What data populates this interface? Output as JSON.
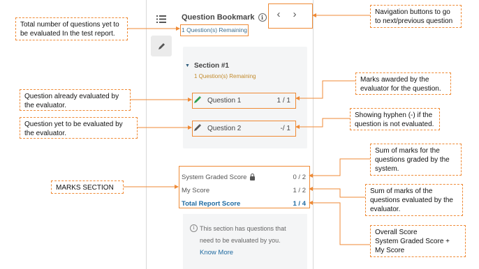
{
  "panel": {
    "title": "Question Bookmark",
    "info_icon": "i",
    "remaining": "1 Question(s) Remaining",
    "nav_prev": "‹",
    "nav_next": "›",
    "section": {
      "name": "Section #1",
      "remaining": "1 Question(s) Remaining",
      "questions": [
        {
          "label": "Question 1",
          "score": "1 / 1",
          "icon": "pencil-icon"
        },
        {
          "label": "Question 2",
          "score": "-/ 1",
          "icon": "pencil-icon"
        }
      ]
    },
    "scores": {
      "system_label": "System Graded Score",
      "system_value": "0 / 2",
      "my_label": "My Score",
      "my_value": "1 / 2",
      "total_label": "Total Report Score",
      "total_value": "1 / 4"
    },
    "note": {
      "text": "This section has questions that need to be evaluated by you.",
      "link": "Know More"
    }
  },
  "callouts": {
    "total_pending": "Total number of questions yet to be evaluated In the test report.",
    "nav_buttons": "Navigation buttons to go to next/previous question",
    "marks_awarded": "Marks awarded by the evaluator for the question.",
    "already_evaluated": "Question already evaluated by the evaluator.",
    "hyphen": "Showing hyphen (-) if the question is not evaluated.",
    "not_evaluated": "Question yet to be evaluated by the evaluator.",
    "system_sum": "Sum of marks for the questions graded by the system.",
    "marks_section": "MARKS SECTION",
    "my_sum": "Sum of marks of the questions evaluated by the evaluator.",
    "overall_title": "Overall Score",
    "overall_formula": "System Graded Score + My Score"
  },
  "colors": {
    "accent_orange": "#ef8a35",
    "link_blue": "#1f6aa0",
    "evaluated_green": "#2e9e4f"
  }
}
